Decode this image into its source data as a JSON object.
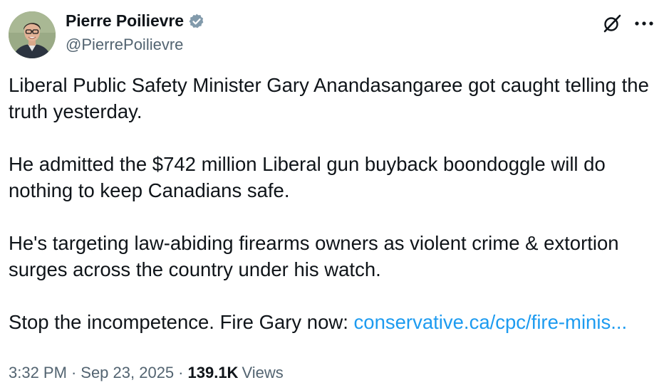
{
  "author": {
    "display_name": "Pierre Poilievre",
    "handle": "@PierrePoilievre",
    "verified_badge_color": "#829aab"
  },
  "icons": {
    "avatar": "profile-photo",
    "verified": "verified-badge-icon",
    "grok": "grok-icon",
    "more": "more-options-icon"
  },
  "tweet": {
    "paragraphs": [
      "Liberal Public Safety Minister Gary Anandasangaree got caught telling the truth yesterday.",
      "He admitted the $742 million Liberal gun buyback boondoggle will do nothing to keep Canadians safe.",
      "He's targeting law-abiding firearms owners as violent crime & extortion surges across the country under his watch."
    ],
    "last_paragraph_text": "Stop the incompetence. Fire Gary now: ",
    "link_text": "conservative.ca/cpc/fire-minis...",
    "link_color": "#1d9bf0"
  },
  "meta": {
    "time": "3:32 PM",
    "separator": "·",
    "date": "Sep 23, 2025",
    "views_count": "139.1K",
    "views_label": "Views"
  }
}
